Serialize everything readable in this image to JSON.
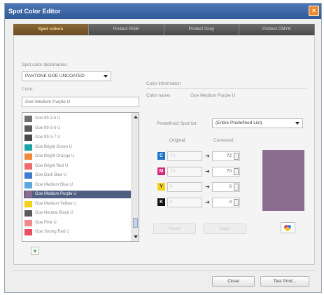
{
  "window": {
    "title": "Spot Color Editor"
  },
  "tabs": [
    "Spot colors",
    "Protect RGB",
    "Protect Gray",
    "Protect CMYK"
  ],
  "left": {
    "dictionaries_label": "Spot color dictionaries:",
    "dictionary_value": "PANTONE GOE UNCOATED",
    "color_label": "Color:",
    "color_value": "Goe Medium Purple U",
    "items": [
      {
        "label": "Goe 99-3-5 U",
        "color": "#6f6f6f"
      },
      {
        "label": "Goe 99-3-6 U",
        "color": "#5c5c5c"
      },
      {
        "label": "Goe 99-3-7 U",
        "color": "#4a4a4a"
      },
      {
        "label": "Goe Bright Green U",
        "color": "#1ca3a8"
      },
      {
        "label": "Goe Bright Orange U",
        "color": "#f08a3a"
      },
      {
        "label": "Goe Bright Red U",
        "color": "#ef6a6a"
      },
      {
        "label": "Goe Dark Blue U",
        "color": "#3f7ad0"
      },
      {
        "label": "Goe Medium Blue U",
        "color": "#5ba8dc"
      },
      {
        "label": "Goe Medium Purple U",
        "color": "#8a6d90",
        "selected": true
      },
      {
        "label": "Goe Medium Yellow U",
        "color": "#f2d21a"
      },
      {
        "label": "Goe Neutral Black U",
        "color": "#5a5a5a"
      },
      {
        "label": "Goe Pink U",
        "color": "#f08a8a"
      },
      {
        "label": "Goe Strong Red U",
        "color": "#e85060"
      }
    ]
  },
  "right": {
    "info_label": "Color information",
    "name_label": "Color name:",
    "name_value": "Goe Medium Purple U",
    "predefined_label": "Predefined Spot list:",
    "predefined_value": "(Entire Predefined List)",
    "original_label": "Original:",
    "corrected_label": "Corrected:",
    "channels": [
      {
        "letter": "C",
        "color": "#1e73c8",
        "original": "72",
        "corrected": "72"
      },
      {
        "letter": "M",
        "color": "#d8287a",
        "original": "70",
        "corrected": "70"
      },
      {
        "letter": "Y",
        "color": "#f2d21a",
        "original": "0",
        "corrected": "0"
      },
      {
        "letter": "K",
        "color": "#111111",
        "original": "0",
        "corrected": "0"
      }
    ],
    "reset_label": "Reset",
    "apply_label": "Apply"
  },
  "footer": {
    "close_label": "Close",
    "test_print_label": "Test Print..."
  },
  "preview_color": "#8a6d90"
}
